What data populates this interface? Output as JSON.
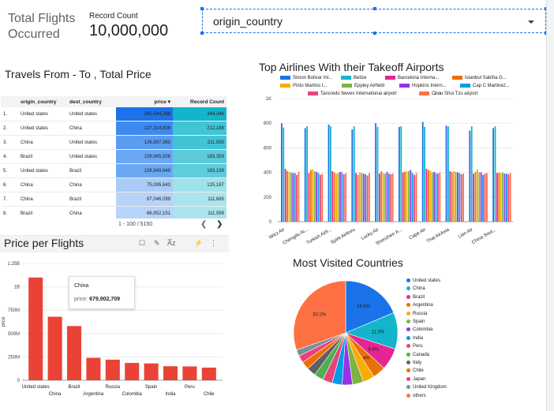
{
  "kpi": {
    "label": "Total Flights Occurred",
    "record_label": "Record Count",
    "record_value": "10,000,000"
  },
  "filter": {
    "selected": "origin_country"
  },
  "table": {
    "title": "Travels From - To , Total Price",
    "headers": [
      "origin_country",
      "dest_country",
      "price ▾",
      "Record Count"
    ],
    "rows": [
      {
        "idx": "1.",
        "origin": "United states",
        "dest": "United states",
        "price": "205,544,288",
        "count": "344,346"
      },
      {
        "idx": "2.",
        "origin": "United states",
        "dest": "China",
        "price": "127,314,836",
        "count": "212,188"
      },
      {
        "idx": "3.",
        "origin": "China",
        "dest": "United states",
        "price": "126,897,383",
        "count": "211,583"
      },
      {
        "idx": "4.",
        "origin": "Brazil",
        "dest": "United states",
        "price": "109,965,508",
        "count": "183,359"
      },
      {
        "idx": "5.",
        "origin": "United states",
        "dest": "Brazil",
        "price": "109,949,649",
        "count": "183,199"
      },
      {
        "idx": "6.",
        "origin": "China",
        "dest": "China",
        "price": "75,095,643",
        "count": "125,187"
      },
      {
        "idx": "7.",
        "origin": "China",
        "dest": "Brazil",
        "price": "67,046,099",
        "count": "111,685"
      },
      {
        "idx": "8.",
        "origin": "Brazil",
        "dest": "China",
        "price": "66,952,151",
        "count": "111,599"
      }
    ],
    "pagination": "1 - 100 / 5150",
    "price_shades": [
      "#1a73e8",
      "#3d8af0",
      "#5a9cf2",
      "#6aa7f3",
      "#6ba8f3",
      "#a9cbf7",
      "#b7d4f8",
      "#b8d4f8"
    ],
    "count_shades": [
      "#12b5cb",
      "#41c4d6",
      "#42c4d6",
      "#5ccbdb",
      "#5dccdb",
      "#a0e1ea",
      "#abe4ec",
      "#abe4ec"
    ]
  },
  "ppf": {
    "title": "Price per Flights",
    "tooltip": {
      "name": "China",
      "metric": "price:",
      "value": "679,902,709"
    }
  },
  "airlines": {
    "title": "Top Airlines With  their Takeoff Airports",
    "legend": [
      {
        "name": "Simon Bolivar Int...",
        "color": "#1a73e8"
      },
      {
        "name": "Belize",
        "color": "#12b5cb"
      },
      {
        "name": "Barcelona Interna...",
        "color": "#e52592"
      },
      {
        "name": "Istanbul Sabiha G...",
        "color": "#e8710a"
      },
      {
        "name": "Pinto Martins I...",
        "color": "#f9ab00"
      },
      {
        "name": "Eppley Airfield",
        "color": "#7cb342"
      },
      {
        "name": "Hopkins Intern...",
        "color": "#9334e6"
      },
      {
        "name": "Cap C Martinez...",
        "color": "#039be5"
      },
      {
        "name": "Tancredo Neves International airport",
        "color": "#e8437a"
      },
      {
        "name": "Chou Shui Tzu airport",
        "color": "#ff7043"
      }
    ]
  },
  "countries": {
    "title": "Most Visited Countries",
    "legend": [
      {
        "name": "United states",
        "color": "#1a73e8"
      },
      {
        "name": "China",
        "color": "#12b5cb"
      },
      {
        "name": "Brazil",
        "color": "#e52592"
      },
      {
        "name": "Argentina",
        "color": "#e8710a"
      },
      {
        "name": "Russia",
        "color": "#f9ab00"
      },
      {
        "name": "Spain",
        "color": "#7cb342"
      },
      {
        "name": "Colombia",
        "color": "#9334e6"
      },
      {
        "name": "India",
        "color": "#039be5"
      },
      {
        "name": "Peru",
        "color": "#e8437a"
      },
      {
        "name": "Canada",
        "color": "#4caf50"
      },
      {
        "name": "Italy",
        "color": "#616161"
      },
      {
        "name": "Chile",
        "color": "#ef6c00"
      },
      {
        "name": "Japan",
        "color": "#ec407a"
      },
      {
        "name": "United Kingdom",
        "color": "#78909c"
      },
      {
        "name": "others",
        "color": "#ff7043"
      }
    ]
  },
  "chart_data": [
    {
      "type": "bar",
      "title": "Price per Flights",
      "ylabel": "price",
      "categories": [
        "United states",
        "China",
        "Brazil",
        "Argentina",
        "Russia",
        "Colombia",
        "Spain",
        "India",
        "Peru",
        "Chile"
      ],
      "values": [
        1100000000,
        679902709,
        580000000,
        240000000,
        220000000,
        185000000,
        180000000,
        150000000,
        148000000,
        135000000
      ],
      "ylim": [
        0,
        1250000000
      ],
      "yticks": [
        "0",
        "250M",
        "500M",
        "750M",
        "1B",
        "1.25B"
      ],
      "color": "#ea4335"
    },
    {
      "type": "bar",
      "title": "Top Airlines With  their Takeoff Airports",
      "categories": [
        "Wizz Air",
        "Chengdu Ai...",
        "Turkish Airli...",
        "Spirit Airlines",
        "Lucky Air",
        "Shenzhen A...",
        "Cape Air",
        "Thai AirAsia",
        "Lion Air",
        "China Sout..."
      ],
      "ylim": [
        0,
        1000
      ],
      "yticks": [
        "0",
        "200",
        "400",
        "600",
        "800",
        "1K"
      ],
      "series": [
        {
          "name": "Simon Bolivar Int...",
          "values": [
            800,
            760,
            790,
            750,
            800,
            770,
            810,
            780,
            740,
            760
          ]
        },
        {
          "name": "Belize",
          "values": [
            765,
            775,
            775,
            775,
            770,
            775,
            770,
            775,
            775,
            775
          ]
        },
        {
          "name": "Barcelona Interna...",
          "values": [
            430,
            395,
            410,
            395,
            390,
            400,
            430,
            410,
            390,
            395
          ]
        },
        {
          "name": "Istanbul Sabiha G...",
          "values": [
            410,
            420,
            400,
            380,
            410,
            405,
            420,
            400,
            405,
            400
          ]
        },
        {
          "name": "Pinto Martins I...",
          "values": [
            405,
            425,
            390,
            400,
            395,
            410,
            415,
            410,
            425,
            395
          ]
        },
        {
          "name": "Eppley Airfield",
          "values": [
            400,
            410,
            395,
            395,
            390,
            410,
            400,
            405,
            400,
            400
          ]
        },
        {
          "name": "Hopkins Intern...",
          "values": [
            395,
            405,
            405,
            390,
            405,
            420,
            405,
            400,
            400,
            390
          ]
        },
        {
          "name": "Cap C Martinez...",
          "values": [
            395,
            395,
            400,
            385,
            390,
            395,
            395,
            395,
            380,
            390
          ]
        },
        {
          "name": "Tancredo Neves International airport",
          "values": [
            380,
            380,
            385,
            375,
            385,
            380,
            390,
            385,
            390,
            385
          ]
        },
        {
          "name": "Chou Shui Tzu airport",
          "values": [
            405,
            390,
            395,
            395,
            390,
            395,
            400,
            390,
            395,
            395
          ]
        }
      ]
    },
    {
      "type": "pie",
      "title": "Most Visited Countries",
      "labels": [
        "United states",
        "China",
        "Brazil",
        "Argentina",
        "Russia",
        "Spain",
        "Colombia",
        "India",
        "Peru",
        "Canada",
        "Italy",
        "Chile",
        "Japan",
        "United Kingdom",
        "others"
      ],
      "values": [
        18.6,
        11.3,
        6.8,
        4,
        3.6,
        3.4,
        3.2,
        3.1,
        3.0,
        2.9,
        2.8,
        2.5,
        2.2,
        2.0,
        30.2
      ],
      "data_labels": [
        "18.6%",
        "11.3%",
        "6.8%",
        "4%",
        "",
        "",
        "",
        "",
        "",
        "",
        "",
        "",
        "",
        "",
        "30.2%"
      ]
    }
  ]
}
